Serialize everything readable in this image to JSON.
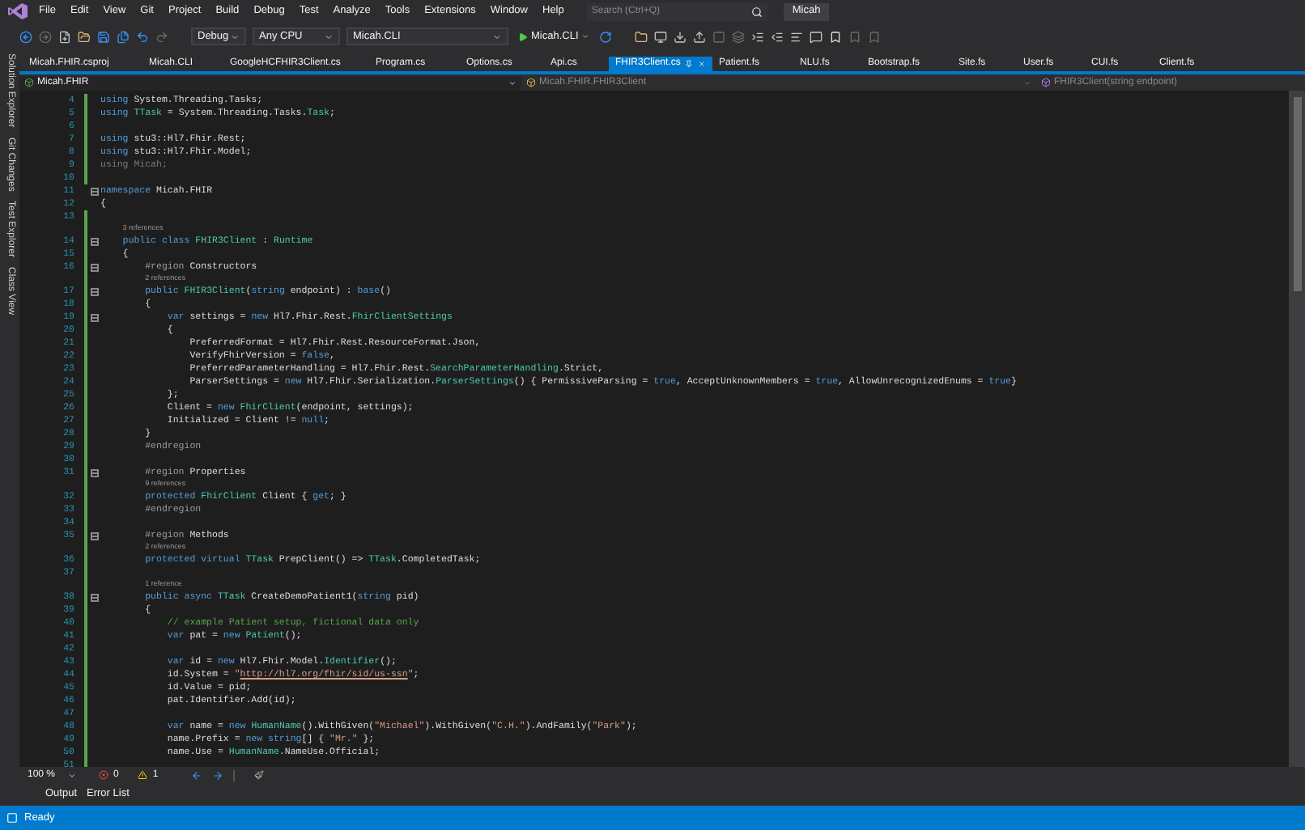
{
  "menu": [
    "File",
    "Edit",
    "View",
    "Git",
    "Project",
    "Build",
    "Debug",
    "Test",
    "Analyze",
    "Tools",
    "Extensions",
    "Window",
    "Help"
  ],
  "search": {
    "placeholder": "Search (Ctrl+Q)"
  },
  "solution_title": "Micah",
  "toolbar": {
    "configuration": "Debug",
    "platform": "Any CPU",
    "startup_project": "Micah.CLI",
    "run_target": "Micah.CLI"
  },
  "side_tabs": [
    "Solution Explorer",
    "Git Changes",
    "Test Explorer",
    "Class View"
  ],
  "tabs": [
    {
      "label": "Micah.FHIR.csproj",
      "selected": false
    },
    {
      "label": "Micah.CLI",
      "selected": false
    },
    {
      "label": "GoogleHCFHIR3Client.cs",
      "selected": false
    },
    {
      "label": "Program.cs",
      "selected": false
    },
    {
      "label": "Options.cs",
      "selected": false
    },
    {
      "label": "Api.cs",
      "selected": false
    },
    {
      "label": "FHIR3Client.cs",
      "selected": true
    },
    {
      "label": "Patient.fs",
      "selected": false
    },
    {
      "label": "NLU.fs",
      "selected": false
    },
    {
      "label": "Bootstrap.fs",
      "selected": false
    },
    {
      "label": "Site.fs",
      "selected": false
    },
    {
      "label": "User.fs",
      "selected": false
    },
    {
      "label": "CUI.fs",
      "selected": false
    },
    {
      "label": "Client.fs",
      "selected": false
    }
  ],
  "navigation": {
    "project": "Micah.FHIR",
    "type": "Micah.FHIR.FHIR3Client",
    "member": "FHIR3Client(string endpoint)"
  },
  "editor": {
    "lines": [
      {
        "number": "4",
        "changed": true,
        "fold": false,
        "tokens": [
          {
            "kind": "keyword",
            "text": "using"
          },
          {
            "kind": "plain",
            "text": " System.Threading.Tasks;"
          }
        ]
      },
      {
        "number": "5",
        "changed": true,
        "fold": false,
        "tokens": [
          {
            "kind": "keyword",
            "text": "using "
          },
          {
            "kind": "type",
            "text": "TTask"
          },
          {
            "kind": "plain",
            "text": " = System.Threading.Tasks."
          },
          {
            "kind": "type",
            "text": "Task"
          },
          {
            "kind": "plain",
            "text": ";"
          }
        ]
      },
      {
        "number": "6",
        "changed": true,
        "fold": false
      },
      {
        "number": "7",
        "changed": true,
        "fold": false,
        "tokens": [
          {
            "kind": "keyword",
            "text": "using"
          },
          {
            "kind": "plain",
            "text": " stu3::Hl7.Fhir.Rest;"
          }
        ]
      },
      {
        "number": "8",
        "changed": true,
        "fold": false,
        "tokens": [
          {
            "kind": "keyword",
            "text": "using"
          },
          {
            "kind": "plain",
            "text": " stu3::Hl7.Fhir.Model;"
          }
        ]
      },
      {
        "number": "9",
        "changed": true,
        "fold": false,
        "tokens": [
          {
            "kind": "dim",
            "text": "using Micah;"
          }
        ]
      },
      {
        "number": "10",
        "changed": true,
        "fold": false
      },
      {
        "number": "11",
        "changed": false,
        "fold": true,
        "tokens": [
          {
            "kind": "keyword",
            "text": "namespace"
          },
          {
            "kind": "plain",
            "text": " Micah.FHIR"
          }
        ]
      },
      {
        "number": "12",
        "changed": false,
        "fold": false,
        "tokens": [
          {
            "kind": "plain",
            "text": "{"
          }
        ]
      },
      {
        "number": "13",
        "changed": true,
        "fold": false
      },
      {
        "number": "14",
        "changed": true,
        "fold": true,
        "codelens": "3 references",
        "tokens": [
          {
            "kind": "keyword",
            "text": "    public class "
          },
          {
            "kind": "type",
            "text": "FHIR3Client"
          },
          {
            "kind": "plain",
            "text": " : "
          },
          {
            "kind": "type",
            "text": "Runtime"
          }
        ]
      },
      {
        "number": "15",
        "changed": true,
        "fold": false,
        "tokens": [
          {
            "kind": "plain",
            "text": "    {"
          }
        ]
      },
      {
        "number": "16",
        "changed": true,
        "fold": true,
        "tokens": [
          {
            "kind": "preprocessor",
            "text": "        #region"
          },
          {
            "kind": "plain",
            "text": " Constructors"
          }
        ]
      },
      {
        "number": "17",
        "changed": true,
        "fold": true,
        "codelens": "2 references",
        "tokens": [
          {
            "kind": "keyword",
            "text": "        public "
          },
          {
            "kind": "type",
            "text": "FHIR3Client"
          },
          {
            "kind": "plain",
            "text": "("
          },
          {
            "kind": "keyword",
            "text": "string"
          },
          {
            "kind": "plain",
            "text": " endpoint) : "
          },
          {
            "kind": "keyword",
            "text": "base"
          },
          {
            "kind": "plain",
            "text": "()"
          }
        ]
      },
      {
        "number": "18",
        "changed": true,
        "fold": false,
        "tokens": [
          {
            "kind": "plain",
            "text": "        {"
          }
        ]
      },
      {
        "number": "19",
        "changed": true,
        "fold": true,
        "tokens": [
          {
            "kind": "keyword",
            "text": "            var"
          },
          {
            "kind": "plain",
            "text": " settings = "
          },
          {
            "kind": "keyword",
            "text": "new"
          },
          {
            "kind": "plain",
            "text": " Hl7.Fhir.Rest."
          },
          {
            "kind": "type",
            "text": "FhirClientSettings"
          }
        ]
      },
      {
        "number": "20",
        "changed": true,
        "fold": false,
        "tokens": [
          {
            "kind": "plain",
            "text": "            {"
          }
        ]
      },
      {
        "number": "21",
        "changed": true,
        "fold": false,
        "tokens": [
          {
            "kind": "plain",
            "text": "                PreferredFormat = Hl7.Fhir.Rest.ResourceFormat.Json,"
          }
        ]
      },
      {
        "number": "22",
        "changed": true,
        "fold": false,
        "tokens": [
          {
            "kind": "plain",
            "text": "                VerifyFhirVersion = "
          },
          {
            "kind": "keyword",
            "text": "false"
          },
          {
            "kind": "plain",
            "text": ","
          }
        ]
      },
      {
        "number": "23",
        "changed": true,
        "fold": false,
        "tokens": [
          {
            "kind": "plain",
            "text": "                PreferredParameterHandling = Hl7.Fhir.Rest."
          },
          {
            "kind": "type",
            "text": "SearchParameterHandling"
          },
          {
            "kind": "plain",
            "text": ".Strict,"
          }
        ]
      },
      {
        "number": "24",
        "changed": true,
        "fold": false,
        "tokens": [
          {
            "kind": "plain",
            "text": "                ParserSettings = "
          },
          {
            "kind": "keyword",
            "text": "new"
          },
          {
            "kind": "plain",
            "text": " Hl7.Fhir.Serialization."
          },
          {
            "kind": "type",
            "text": "ParserSettings"
          },
          {
            "kind": "plain",
            "text": "() { PermissiveParsing = "
          },
          {
            "kind": "keyword",
            "text": "true"
          },
          {
            "kind": "plain",
            "text": ", AcceptUnknownMembers = "
          },
          {
            "kind": "keyword",
            "text": "true"
          },
          {
            "kind": "plain",
            "text": ", AllowUnrecognizedEnums = "
          },
          {
            "kind": "keyword",
            "text": "true"
          },
          {
            "kind": "plain",
            "text": "}"
          }
        ]
      },
      {
        "number": "25",
        "changed": true,
        "fold": false,
        "tokens": [
          {
            "kind": "plain",
            "text": "            };"
          }
        ]
      },
      {
        "number": "26",
        "changed": true,
        "fold": false,
        "tokens": [
          {
            "kind": "plain",
            "text": "            Client = "
          },
          {
            "kind": "keyword",
            "text": "new "
          },
          {
            "kind": "type",
            "text": "FhirClient"
          },
          {
            "kind": "plain",
            "text": "(endpoint, settings);"
          }
        ]
      },
      {
        "number": "27",
        "changed": true,
        "fold": false,
        "tokens": [
          {
            "kind": "plain",
            "text": "            Initialized = Client != "
          },
          {
            "kind": "keyword",
            "text": "null"
          },
          {
            "kind": "plain",
            "text": ";"
          }
        ]
      },
      {
        "number": "28",
        "changed": true,
        "fold": false,
        "tokens": [
          {
            "kind": "plain",
            "text": "        }"
          }
        ]
      },
      {
        "number": "29",
        "changed": true,
        "fold": false,
        "tokens": [
          {
            "kind": "preprocessor",
            "text": "        #endregion"
          }
        ]
      },
      {
        "number": "30",
        "changed": true,
        "fold": false
      },
      {
        "number": "31",
        "changed": true,
        "fold": true,
        "tokens": [
          {
            "kind": "preprocessor",
            "text": "        #region"
          },
          {
            "kind": "plain",
            "text": " Properties"
          }
        ]
      },
      {
        "number": "32",
        "changed": true,
        "fold": false,
        "codelens": "9 references",
        "tokens": [
          {
            "kind": "keyword",
            "text": "        protected "
          },
          {
            "kind": "type",
            "text": "FhirClient"
          },
          {
            "kind": "plain",
            "text": " Client { "
          },
          {
            "kind": "keyword",
            "text": "get"
          },
          {
            "kind": "plain",
            "text": "; }"
          }
        ]
      },
      {
        "number": "33",
        "changed": true,
        "fold": false,
        "tokens": [
          {
            "kind": "preprocessor",
            "text": "        #endregion"
          }
        ]
      },
      {
        "number": "34",
        "changed": true,
        "fold": false
      },
      {
        "number": "35",
        "changed": true,
        "fold": true,
        "tokens": [
          {
            "kind": "preprocessor",
            "text": "        #region"
          },
          {
            "kind": "plain",
            "text": " Methods"
          }
        ]
      },
      {
        "number": "36",
        "changed": true,
        "fold": false,
        "codelens": "2 references",
        "tokens": [
          {
            "kind": "keyword",
            "text": "        protected virtual "
          },
          {
            "kind": "type",
            "text": "TTask"
          },
          {
            "kind": "plain",
            "text": " PrepClient() => "
          },
          {
            "kind": "type",
            "text": "TTask"
          },
          {
            "kind": "plain",
            "text": ".CompletedTask;"
          }
        ]
      },
      {
        "number": "37",
        "changed": true,
        "fold": false
      },
      {
        "number": "38",
        "changed": true,
        "fold": true,
        "codelens": "1 reference",
        "tokens": [
          {
            "kind": "keyword",
            "text": "        public async "
          },
          {
            "kind": "type",
            "text": "TTask"
          },
          {
            "kind": "plain",
            "text": " CreateDemoPatient1("
          },
          {
            "kind": "keyword",
            "text": "string"
          },
          {
            "kind": "plain",
            "text": " pid)"
          }
        ]
      },
      {
        "number": "39",
        "changed": true,
        "fold": false,
        "tokens": [
          {
            "kind": "plain",
            "text": "        {"
          }
        ]
      },
      {
        "number": "40",
        "changed": true,
        "fold": false,
        "tokens": [
          {
            "kind": "comment",
            "text": "            // example Patient setup, fictional data only"
          }
        ]
      },
      {
        "number": "41",
        "changed": true,
        "fold": false,
        "tokens": [
          {
            "kind": "keyword",
            "text": "            var"
          },
          {
            "kind": "plain",
            "text": " pat = "
          },
          {
            "kind": "keyword",
            "text": "new "
          },
          {
            "kind": "type",
            "text": "Patient"
          },
          {
            "kind": "plain",
            "text": "();"
          }
        ]
      },
      {
        "number": "42",
        "changed": true,
        "fold": false
      },
      {
        "number": "43",
        "changed": true,
        "fold": false,
        "tokens": [
          {
            "kind": "keyword",
            "text": "            var"
          },
          {
            "kind": "plain",
            "text": " id = "
          },
          {
            "kind": "keyword",
            "text": "new"
          },
          {
            "kind": "plain",
            "text": " Hl7.Fhir.Model."
          },
          {
            "kind": "type",
            "text": "Identifier"
          },
          {
            "kind": "plain",
            "text": "();"
          }
        ]
      },
      {
        "number": "44",
        "changed": true,
        "fold": false,
        "tokens": [
          {
            "kind": "plain",
            "text": "            id.System = "
          },
          {
            "kind": "string",
            "text": "\""
          },
          {
            "kind": "link",
            "text": "http://hl7.org/fhir/sid/us-ssn"
          },
          {
            "kind": "string",
            "text": "\""
          },
          {
            "kind": "plain",
            "text": ";"
          }
        ]
      },
      {
        "number": "45",
        "changed": true,
        "fold": false,
        "tokens": [
          {
            "kind": "plain",
            "text": "            id.Value = pid;"
          }
        ]
      },
      {
        "number": "46",
        "changed": true,
        "fold": false,
        "tokens": [
          {
            "kind": "plain",
            "text": "            pat.Identifier.Add(id);"
          }
        ]
      },
      {
        "number": "47",
        "changed": true,
        "fold": false
      },
      {
        "number": "48",
        "changed": true,
        "fold": false,
        "tokens": [
          {
            "kind": "keyword",
            "text": "            var"
          },
          {
            "kind": "plain",
            "text": " name = "
          },
          {
            "kind": "keyword",
            "text": "new "
          },
          {
            "kind": "type",
            "text": "HumanName"
          },
          {
            "kind": "plain",
            "text": "().WithGiven("
          },
          {
            "kind": "string",
            "text": "\"Michael\""
          },
          {
            "kind": "plain",
            "text": ").WithGiven("
          },
          {
            "kind": "string",
            "text": "\"C.H.\""
          },
          {
            "kind": "plain",
            "text": ").AndFamily("
          },
          {
            "kind": "string",
            "text": "\"Park\""
          },
          {
            "kind": "plain",
            "text": ");"
          }
        ]
      },
      {
        "number": "49",
        "changed": true,
        "fold": false,
        "tokens": [
          {
            "kind": "plain",
            "text": "            name.Prefix = "
          },
          {
            "kind": "keyword",
            "text": "new "
          },
          {
            "kind": "keyword",
            "text": "string"
          },
          {
            "kind": "plain",
            "text": "[] { "
          },
          {
            "kind": "string",
            "text": "\"Mr.\""
          },
          {
            "kind": "plain",
            "text": " };"
          }
        ]
      },
      {
        "number": "50",
        "changed": true,
        "fold": false,
        "tokens": [
          {
            "kind": "plain",
            "text": "            name.Use = "
          },
          {
            "kind": "type",
            "text": "HumanName"
          },
          {
            "kind": "plain",
            "text": ".NameUse.Official;"
          }
        ]
      },
      {
        "number": "51",
        "changed": true,
        "fold": false
      }
    ]
  },
  "editor_status": {
    "zoom": "100 %",
    "errors": "0",
    "warnings": "1"
  },
  "panel_tabs": [
    "Output",
    "Error List"
  ],
  "status_bar": {
    "text": "Ready"
  }
}
